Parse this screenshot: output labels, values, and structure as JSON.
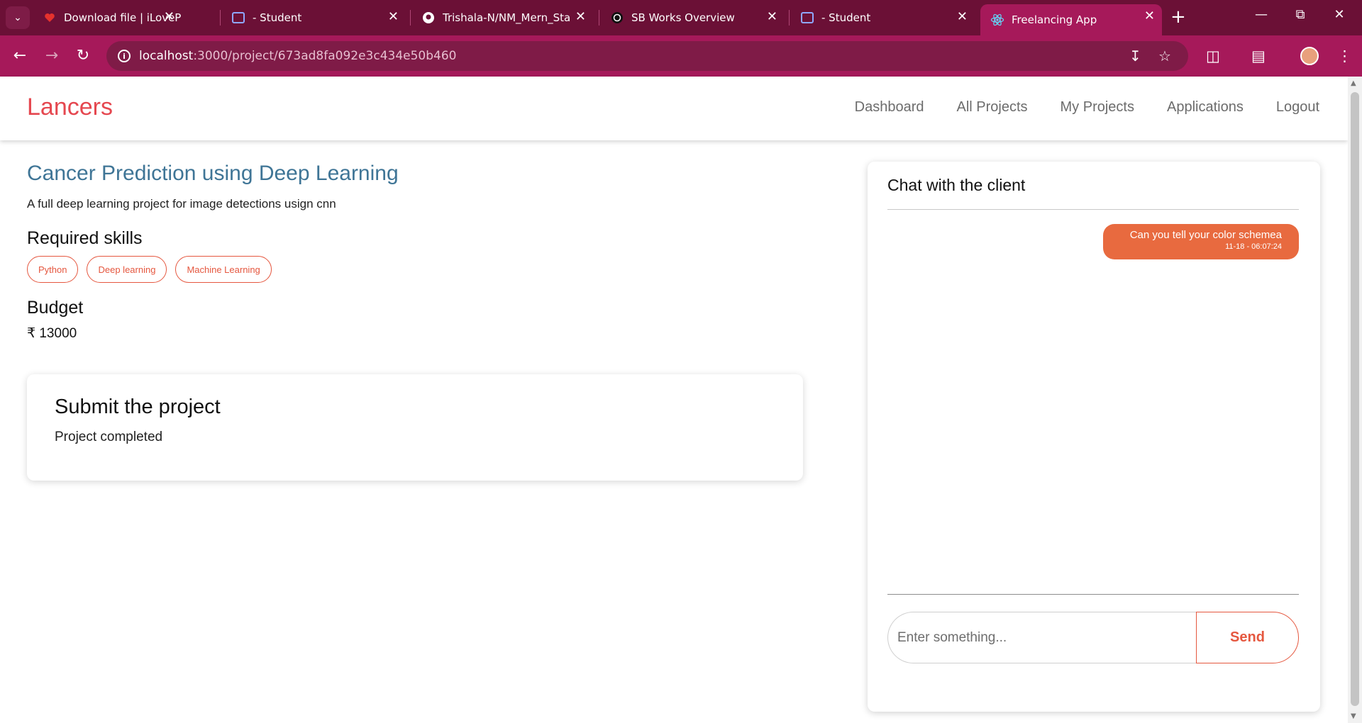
{
  "browser": {
    "tabs": [
      {
        "label": "Download file | iLovePDF",
        "icon": "heart-icon",
        "active": false
      },
      {
        "label": "- Student",
        "icon": "page-icon",
        "active": false
      },
      {
        "label": "Trishala-N/NM_Mern_Stack",
        "icon": "github-icon",
        "active": false
      },
      {
        "label": "SB Works Overview",
        "icon": "openai-icon",
        "active": false
      },
      {
        "label": "- Student",
        "icon": "page-icon",
        "active": false
      },
      {
        "label": "Freelancing App",
        "icon": "react-icon",
        "active": true
      }
    ],
    "url_host": "localhost",
    "url_path": ":3000/project/673ad8fa092e3c434e50b460",
    "colors": {
      "tabbar": "#6b1036",
      "toolbar": "#a6195a",
      "omnibox": "#7f1b47"
    }
  },
  "navbar": {
    "brand": "Lancers",
    "links": [
      "Dashboard",
      "All Projects",
      "My Projects",
      "Applications",
      "Logout"
    ]
  },
  "project": {
    "title": "Cancer Prediction using Deep Learning",
    "description": "A full deep learning project for image detections usign cnn",
    "skills_heading": "Required skills",
    "skills": [
      "Python",
      "Deep learning",
      "Machine Learning"
    ],
    "budget_heading": "Budget",
    "budget_value": "₹ 13000"
  },
  "submit": {
    "heading": "Submit the project",
    "status": "Project completed"
  },
  "chat": {
    "heading": "Chat with the client",
    "messages": [
      {
        "text": "Can you tell your color schemea",
        "time": "11-18 - 06:07:24"
      }
    ],
    "input_placeholder": "Enter something...",
    "send_label": "Send"
  },
  "colors": {
    "brand": "#e5474f",
    "title": "#3f7596",
    "accent": "#e5573f",
    "bubble": "#e86a3f"
  }
}
